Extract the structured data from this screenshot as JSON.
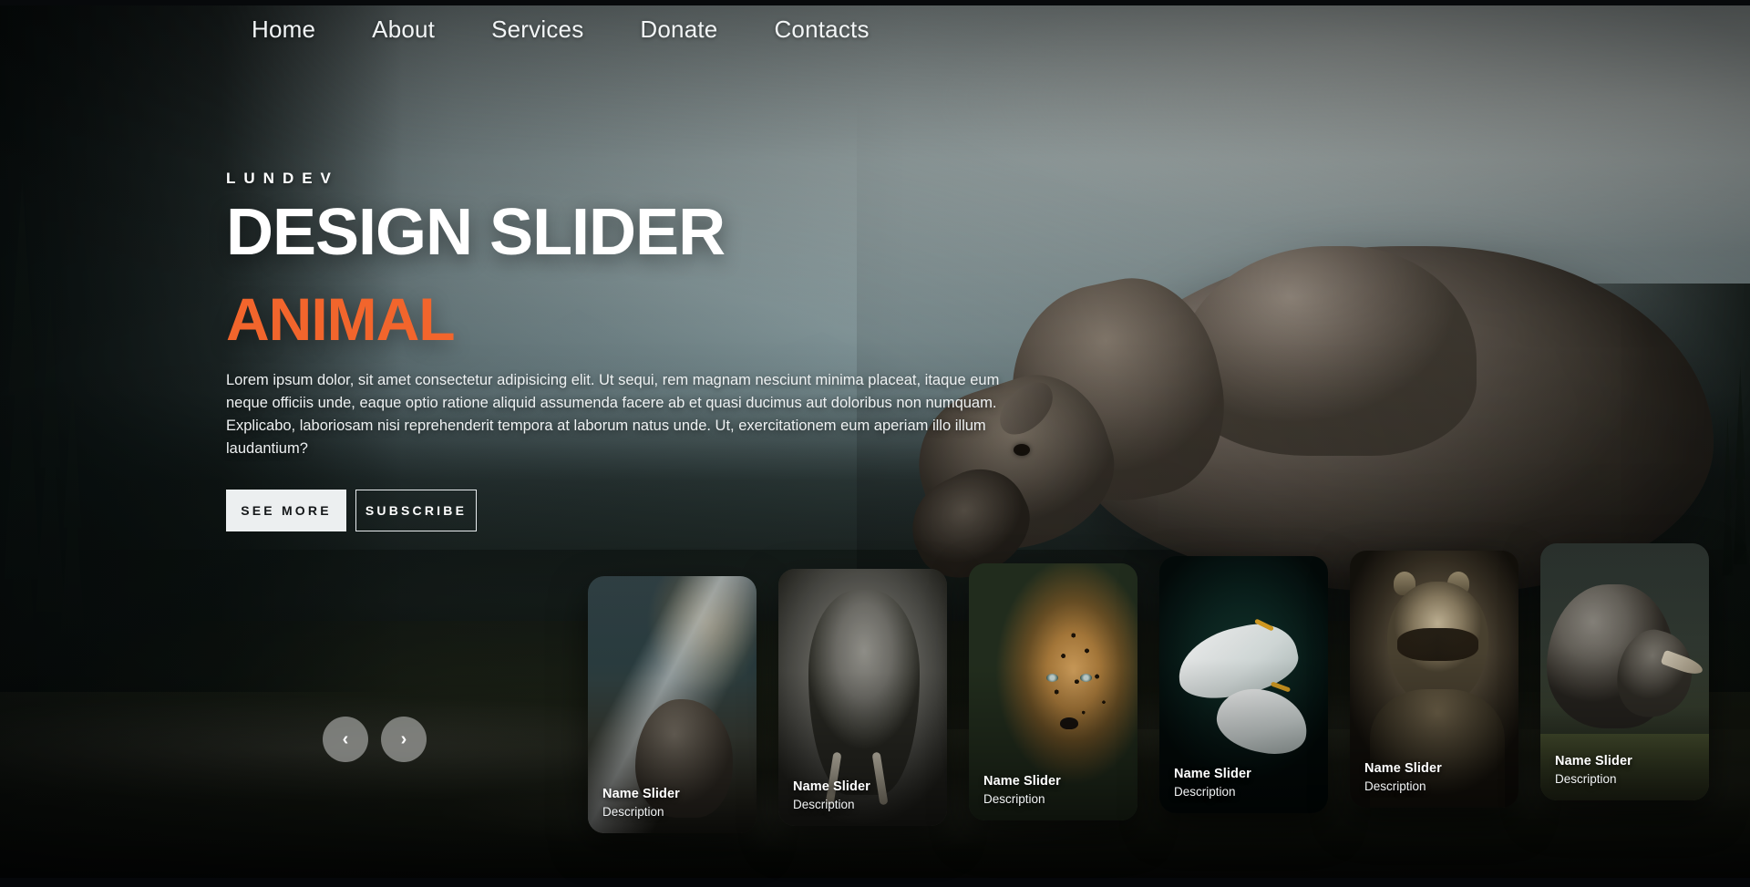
{
  "nav": {
    "items": [
      {
        "label": "Home"
      },
      {
        "label": "About"
      },
      {
        "label": "Services"
      },
      {
        "label": "Donate"
      },
      {
        "label": "Contacts"
      }
    ]
  },
  "hero": {
    "eyebrow": "LUNDEV",
    "title": "DESIGN SLIDER",
    "subtitle": "ANIMAL",
    "description": "Lorem ipsum dolor, sit amet consectetur adipisicing elit. Ut sequi, rem magnam nesciunt minima placeat, itaque eum neque officiis unde, eaque optio ratione aliquid assumenda facere ab et quasi ducimus aut doloribus non numquam. Explicabo, laboriosam nisi reprehenderit tempora at laborum natus unde. Ut, exercitationem eum aperiam illo illum laudantium?",
    "primary_button": "SEE MORE",
    "secondary_button": "SUBSCRIBE",
    "accent_color": "#f2652c",
    "title_color": "#ffffff"
  },
  "carousel": {
    "prev_label": "‹",
    "next_label": "›",
    "prev_icon": "chevron-left-icon",
    "next_icon": "chevron-right-icon",
    "items": [
      {
        "title": "Name Slider",
        "description": "Description",
        "subject": "elephant-in-sunbeam-forest"
      },
      {
        "title": "Name Slider",
        "description": "Description",
        "subject": "elephant-face-closeup"
      },
      {
        "title": "Name Slider",
        "description": "Description",
        "subject": "leopard-in-jungle"
      },
      {
        "title": "Name Slider",
        "description": "Description",
        "subject": "white-egrets-on-water"
      },
      {
        "title": "Name Slider",
        "description": "Description",
        "subject": "raccoon-portrait"
      },
      {
        "title": "Name Slider",
        "description": "Description",
        "subject": "rhinoceros"
      }
    ]
  },
  "background": {
    "subject": "moose-in-misty-forest",
    "sky_color": "#a9b8b9",
    "forest_color": "#1a231f"
  }
}
